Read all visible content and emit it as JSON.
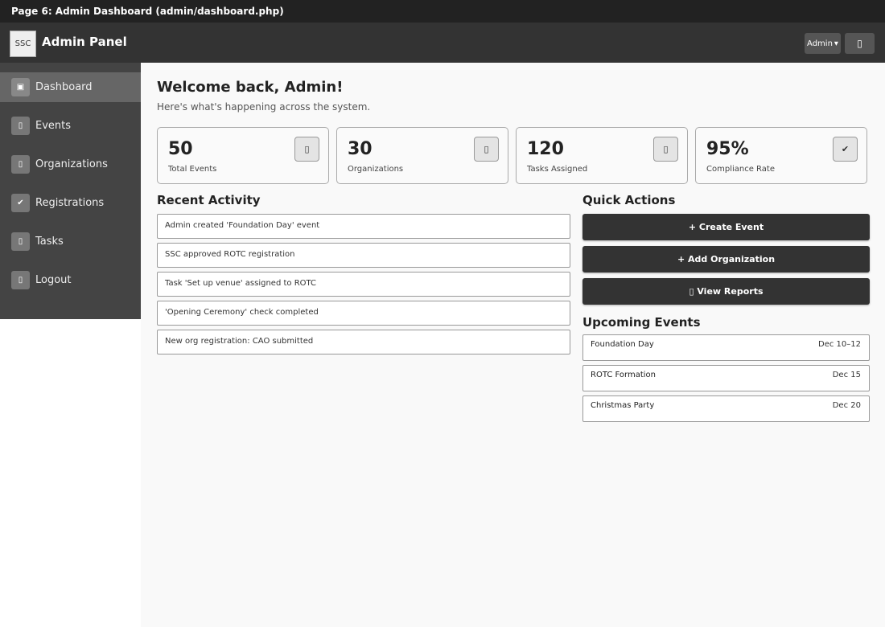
{
  "page_caption": "Page 6: Admin Dashboard (admin/dashboard.php)",
  "header": {
    "logo_text": "SSC",
    "title": "Admin Panel",
    "user_menu_label": "Admin",
    "user_menu_caret": "▾",
    "notif_icon": "▯"
  },
  "sidebar": {
    "items": [
      {
        "label": "Dashboard",
        "icon": "▣",
        "icon_name": "dashboard-icon"
      },
      {
        "label": "Events",
        "icon": "▯",
        "icon_name": "calendar-icon"
      },
      {
        "label": "Organizations",
        "icon": "▯",
        "icon_name": "organization-icon"
      },
      {
        "label": "Registrations",
        "icon": "✔",
        "icon_name": "check-icon"
      },
      {
        "label": "Tasks",
        "icon": "▯",
        "icon_name": "tasks-icon"
      },
      {
        "label": "Logout",
        "icon": "▯",
        "icon_name": "logout-icon"
      }
    ]
  },
  "main": {
    "welcome": "Welcome back, Admin!",
    "subtitle": "Here's what's happening across the system.",
    "stats": [
      {
        "value": "50",
        "label": "Total Events",
        "icon": "▯"
      },
      {
        "value": "30",
        "label": "Organizations",
        "icon": "▯"
      },
      {
        "value": "120",
        "label": "Tasks Assigned",
        "icon": "▯"
      },
      {
        "value": "95%",
        "label": "Compliance Rate",
        "icon": "✔"
      }
    ],
    "recent_activity": {
      "title": "Recent Activity",
      "items": [
        "Admin created 'Foundation Day' event",
        "SSC approved ROTC registration",
        "Task 'Set up venue' assigned to ROTC",
        "'Opening Ceremony' check completed",
        "New org registration: CAO submitted"
      ]
    },
    "quick_actions": {
      "title": "Quick Actions",
      "buttons": [
        "+ Create Event",
        "+ Add Organization",
        "▯ View Reports"
      ]
    },
    "upcoming_events": {
      "title": "Upcoming Events",
      "items": [
        {
          "name": "Foundation Day",
          "date": "Dec 10–12"
        },
        {
          "name": "ROTC Formation",
          "date": "Dec 15"
        },
        {
          "name": "Christmas Party",
          "date": "Dec 20"
        }
      ]
    }
  }
}
